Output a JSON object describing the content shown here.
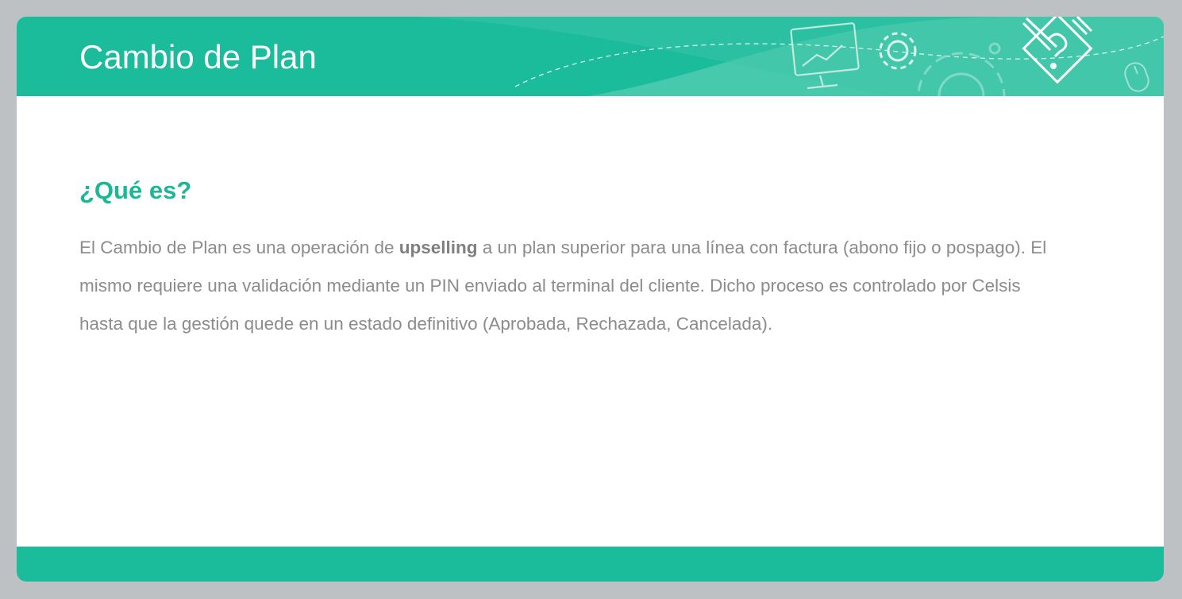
{
  "header": {
    "title": "Cambio de Plan",
    "decoration_icons": [
      "monitor-chart-icon",
      "gear-icon",
      "large-gear-icon",
      "pencil-document-icon",
      "mouse-icon"
    ]
  },
  "section": {
    "heading": "¿Qué es?",
    "paragraph": {
      "before_bold": "El Cambio de Plan es una operación de ",
      "bold": "upselling",
      "after_bold": " a un plan superior para una línea con factura (abono fijo o pospago). El mismo requiere una validación mediante un PIN enviado al terminal del cliente. Dicho proceso es controlado por Celsis hasta que la gestión quede en un estado definitivo (Aprobada, Rechazada, Cancelada)."
    }
  },
  "colors": {
    "accent": "#1BBC9B",
    "heading": "#1BB896",
    "body_text": "#8C8C8C",
    "frame": "#BDC1C4"
  }
}
